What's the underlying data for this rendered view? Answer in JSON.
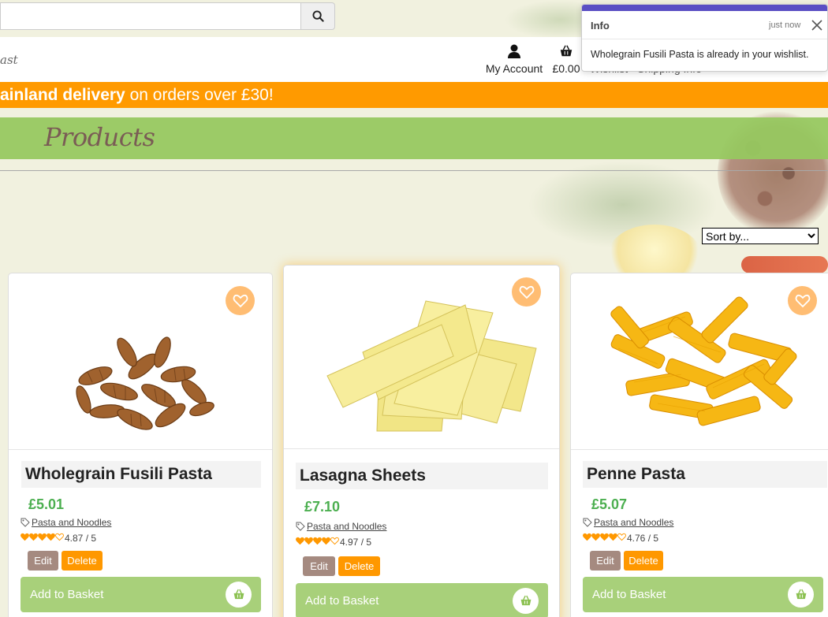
{
  "search": {
    "placeholder": ""
  },
  "header": {
    "brand": "ast",
    "account_label": "My Account",
    "basket_total": "£0.00",
    "wishlist_label": "Wishlist",
    "shipping_label": "Shipping Info"
  },
  "promo": {
    "bold": "ainland delivery",
    "rest": " on orders over £30!"
  },
  "page": {
    "title": "Products"
  },
  "sort": {
    "selected": "Sort by..."
  },
  "toast": {
    "title": "Info",
    "time": "just now",
    "message": "Wholegrain Fusili Pasta is already in your wishlist."
  },
  "products": [
    {
      "name": "Wholegrain Fusili Pasta",
      "price": "£5.01",
      "category": "Pasta and Noodles",
      "rating": "4.87 / 5",
      "edit": "Edit",
      "delete": "Delete",
      "add": "Add to Basket"
    },
    {
      "name": "Lasagna Sheets",
      "price": "£7.10",
      "category": "Pasta and Noodles",
      "rating": "4.97 / 5",
      "edit": "Edit",
      "delete": "Delete",
      "add": "Add to Basket"
    },
    {
      "name": "Penne Pasta",
      "price": "£5.07",
      "category": "Pasta and Noodles",
      "rating": "4.76 / 5",
      "edit": "Edit",
      "delete": "Delete",
      "add": "Add to Basket"
    }
  ],
  "colors": {
    "accent": "#ff9a00",
    "green": "#97c860",
    "price": "#4caf50",
    "toast_bar": "#5a4fc4"
  }
}
